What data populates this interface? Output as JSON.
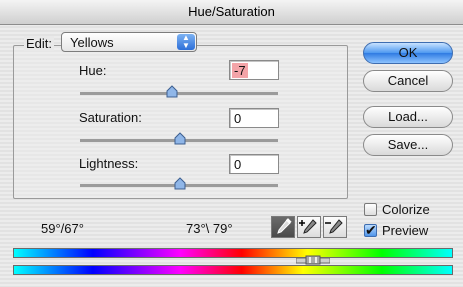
{
  "window": {
    "title": "Hue/Saturation"
  },
  "edit": {
    "label": "Edit:",
    "selected": "Yellows"
  },
  "hue": {
    "label": "Hue:",
    "value": "-7"
  },
  "saturation": {
    "label": "Saturation:",
    "value": "0"
  },
  "lightness": {
    "label": "Lightness:",
    "value": "0"
  },
  "buttons": {
    "ok": "OK",
    "cancel": "Cancel",
    "load": "Load...",
    "save": "Save..."
  },
  "options": {
    "colorize": "Colorize",
    "colorize_checked": false,
    "preview": "Preview",
    "preview_checked": true
  },
  "readouts": {
    "left": "59°/67°",
    "right": "73°\\ 79°"
  },
  "icons": [
    "eyedropper-icon",
    "eyedropper-plus-icon",
    "eyedropper-minus-icon"
  ],
  "colors": {
    "accent": "#2f7be2",
    "highlight": "#f3a4a8"
  }
}
